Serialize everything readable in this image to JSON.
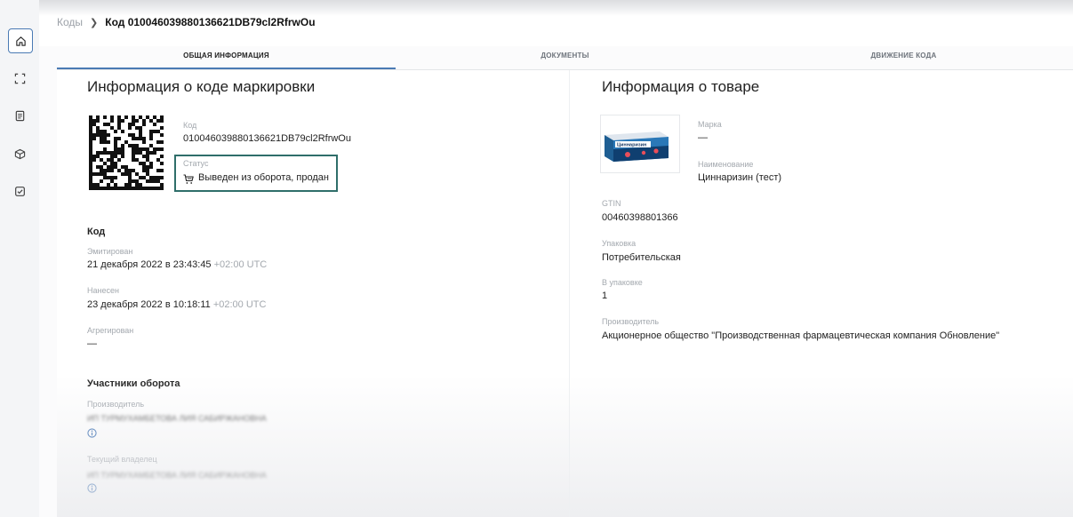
{
  "breadcrumb": {
    "parent": "Коды",
    "current": "Код 010046039880136621DB79cl2RfrwOu"
  },
  "tabs": [
    {
      "label": "ОБЩАЯ ИНФОРМАЦИЯ",
      "active": true
    },
    {
      "label": "ДОКУМЕНТЫ",
      "active": false
    },
    {
      "label": "ДВИЖЕНИЕ КОДА",
      "active": false
    }
  ],
  "sidebar": {
    "items": [
      {
        "icon": "home-icon",
        "active": true
      },
      {
        "icon": "scan-icon"
      },
      {
        "icon": "document-icon"
      },
      {
        "icon": "box-icon"
      },
      {
        "icon": "checkbox-icon"
      }
    ]
  },
  "code_info": {
    "title": "Информация о коде маркировки",
    "code_label": "Код",
    "code_value": "010046039880136621DB79cl2RfrwOu",
    "status_label": "Статус",
    "status_value": "Выведен из оборота, продан",
    "code_section": "Код",
    "emitted_label": "Эмитирован",
    "emitted_value": "21 декабря 2022 в 23:43:45",
    "emitted_tz": "+02:00 UTC",
    "applied_label": "Нанесен",
    "applied_value": "23 декабря 2022 в 10:18:11",
    "applied_tz": "+02:00 UTC",
    "aggregated_label": "Агрегирован",
    "aggregated_value": "—",
    "participants_title": "Участники оборота",
    "producer_label": "Производитель",
    "producer_value": "ИП ТУРМУХАМБЕТОВА ЛИЯ САБИРЖАНОВНА",
    "owner_label": "Текущий владелец",
    "owner_value": "ИП ТУРМУХАМБЕТОВА ЛИЯ САБИРЖАНОВНА"
  },
  "product_info": {
    "title": "Информация о товаре",
    "brand_label": "Марка",
    "brand_value": "—",
    "name_label": "Наименование",
    "name_value": "Циннаризин (тест)",
    "gtin_label": "GTIN",
    "gtin_value": "00460398801366",
    "package_label": "Упаковка",
    "package_value": "Потребительская",
    "in_package_label": "В упаковке",
    "in_package_value": "1",
    "manufacturer_label": "Производитель",
    "manufacturer_value": "Акционерное общество \"Производственная фармацевтическая компания Обновление\"",
    "box_text": "Циннаризин"
  },
  "colors": {
    "accent": "#4a7ab4",
    "status_border": "#2f6e6a"
  }
}
